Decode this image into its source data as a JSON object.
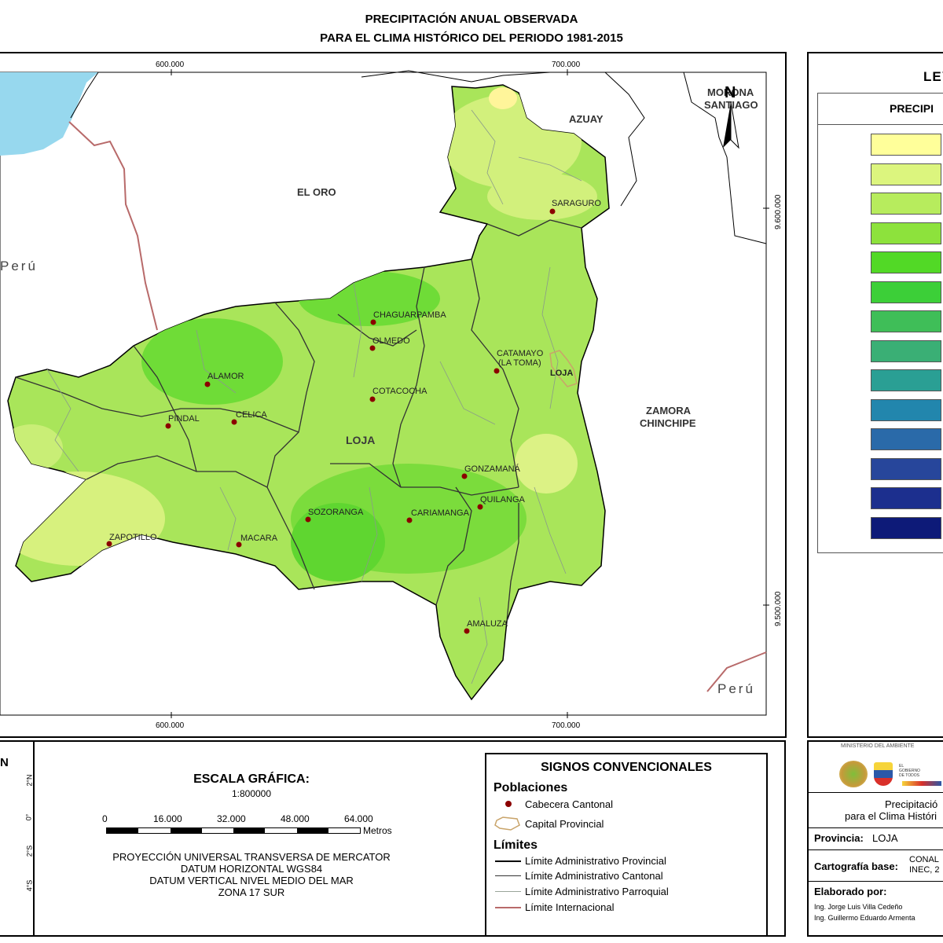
{
  "header": {
    "title_line1": "PRECIPITACIÓN ANUAL OBSERVADA",
    "title_line2": "PARA EL CLIMA HISTÓRICO DEL PERIODO 1981-2015"
  },
  "map": {
    "coords": {
      "top_x1": "600.000",
      "top_x2": "700.000",
      "bottom_x1": "600.000",
      "bottom_x2": "700.000",
      "right_y1": "9.600.000",
      "right_y2": "9.500.000"
    },
    "regions": {
      "el_oro": "EL ORO",
      "azuay": "AZUAY",
      "peru_west": "Perú",
      "peru_south": "Perú",
      "zamora_1": "ZAMORA",
      "zamora_2": "CHINCHIPE",
      "morona_1": "MORONA",
      "morona_2": "SANTIAGO",
      "loja": "LOJA",
      "north_arrow": "N"
    },
    "towns": [
      {
        "name": "SARAGURO"
      },
      {
        "name": "CHAGUARPAMBA"
      },
      {
        "name": "OLMEDO"
      },
      {
        "name": "CATAMAYO"
      },
      {
        "name": "(LA TOMA)"
      },
      {
        "name": "LOJA"
      },
      {
        "name": "ALAMOR"
      },
      {
        "name": "COTACOCHA"
      },
      {
        "name": "PINDAL"
      },
      {
        "name": "CELICA"
      },
      {
        "name": "GONZAMANÁ"
      },
      {
        "name": "QUILANGA"
      },
      {
        "name": "SOZORANGA"
      },
      {
        "name": "CARIAMANGA"
      },
      {
        "name": "ZAPOTILLO"
      },
      {
        "name": "MACARA"
      },
      {
        "name": "AMALUZA"
      }
    ]
  },
  "legend": {
    "title": "LEY",
    "subtitle": "PRECIPI",
    "colors": [
      "#ffff9a",
      "#dcf57e",
      "#b7ec5d",
      "#8de23c",
      "#52d926",
      "#3ccf38",
      "#3fbe58",
      "#3aaf75",
      "#2a9f94",
      "#2286ad",
      "#2a6aa9",
      "#27469b",
      "#1c2f8e",
      "#0d1a78"
    ]
  },
  "scale": {
    "title": "ESCALA GRÁFICA:",
    "ratio": "1:800000",
    "ticks": [
      "0",
      "16.000",
      "32.000",
      "48.000",
      "64.000"
    ],
    "unit": "Metros",
    "proj1": "PROYECCIÓN UNIVERSAL TRANSVERSA DE MERCATOR",
    "proj2": "DATUM HORIZONTAL WGS84",
    "proj3": "DATUM VERTICAL NIVEL MEDIO DEL MAR",
    "proj4": "ZONA 17 SUR"
  },
  "location_inset": {
    "label": "N",
    "ticks": [
      "2°N",
      "0°",
      "2°S",
      "4°S"
    ]
  },
  "signs": {
    "title": "SIGNOS CONVENCIONALES",
    "poblaciones": "Poblaciones",
    "cabecera": "Cabecera Cantonal",
    "capital": "Capital Provincial",
    "limites": "Límites",
    "lim_prov": "Límite Administrativo Provincial",
    "lim_cant": "Límite Administrativo Cantonal",
    "lim_parr": "Límite Administrativo Parroquial",
    "lim_int": "Límite Internacional"
  },
  "info": {
    "ministry": "MINISTERIO DEL AMBIENTE",
    "gob": "EL GOBIERNO DE TODOS",
    "desc1": "Precipitació",
    "desc2": "para el Clima Históri",
    "prov_label": "Provincia:",
    "prov_value": "LOJA",
    "cart_label": "Cartografía base:",
    "cart_value1": "CONAL",
    "cart_value2": "INEC, 2",
    "elab_label": "Elaborado por:",
    "person1": "Ing. Jorge Luis Villa Cedeño",
    "person2": "Ing. Guillermo Eduardo Armenta"
  }
}
